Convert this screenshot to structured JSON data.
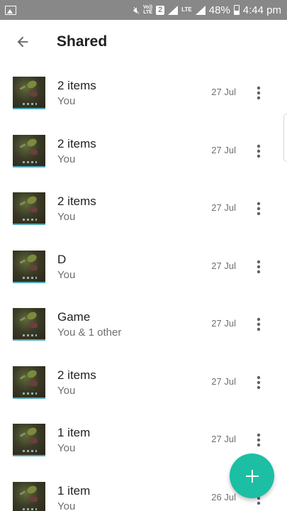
{
  "status_bar": {
    "volte_top": "Vo))",
    "volte_bottom": "LTE",
    "sim": "2",
    "network": "LTE",
    "battery_pct": "48%",
    "time": "4:44 pm",
    "icons": [
      "gallery-icon",
      "mute-icon",
      "signal-icon",
      "battery-icon"
    ]
  },
  "appbar": {
    "title": "Shared",
    "back_icon": "arrow-back-icon"
  },
  "items": [
    {
      "title": "2 items",
      "subtitle": "You",
      "date": "27 Jul"
    },
    {
      "title": "2 items",
      "subtitle": "You",
      "date": "27 Jul"
    },
    {
      "title": "2 items",
      "subtitle": "You",
      "date": "27 Jul"
    },
    {
      "title": "D",
      "subtitle": "You",
      "date": "27 Jul"
    },
    {
      "title": "Game",
      "subtitle": "You & 1 other",
      "date": "27 Jul"
    },
    {
      "title": "2 items",
      "subtitle": "You",
      "date": "27 Jul"
    },
    {
      "title": "1 item",
      "subtitle": "You",
      "date": "27 Jul"
    },
    {
      "title": "1 item",
      "subtitle": "You",
      "date": "26 Jul"
    }
  ],
  "fab": {
    "icon": "plus-icon",
    "color": "#1cbfa3"
  },
  "colors": {
    "status_bar": "#888888",
    "accent": "#1cbfa3"
  }
}
